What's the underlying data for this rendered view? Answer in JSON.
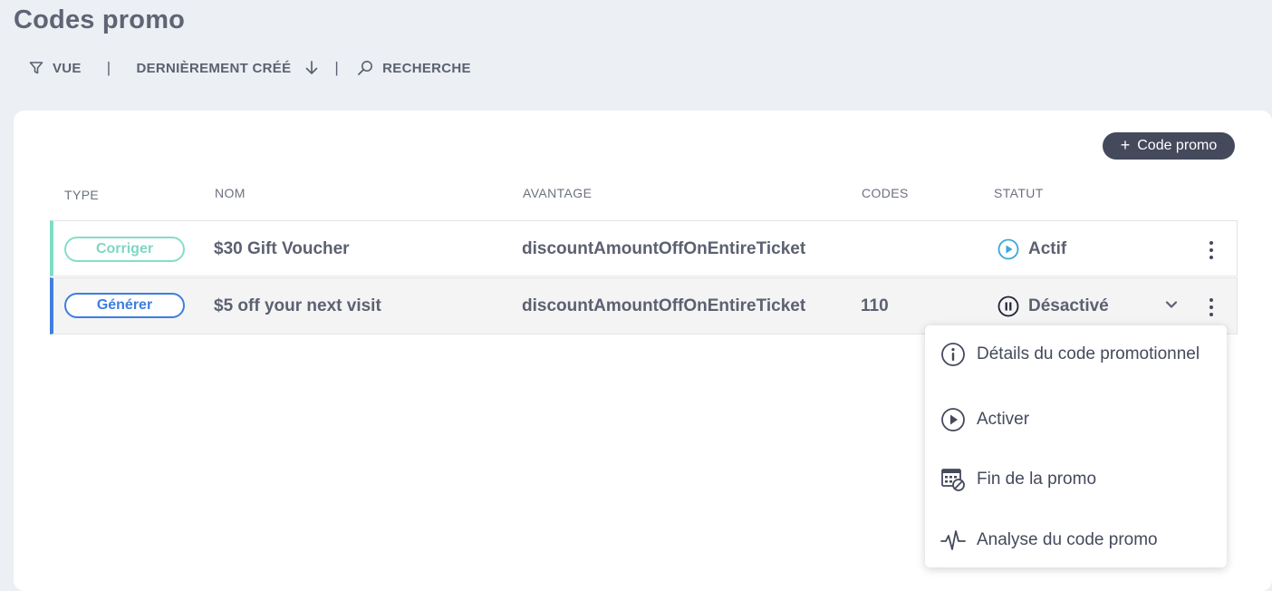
{
  "page": {
    "title": "Codes promo"
  },
  "toolbar": {
    "view_label": "VUE",
    "sort_label": "DERNIÈREMENT CRÉÉ",
    "search_label": "RECHERCHE",
    "separator": "|"
  },
  "actions": {
    "add_label": "Code promo",
    "add_icon": "+"
  },
  "table": {
    "headers": {
      "type": "TYPE",
      "name": "NOM",
      "benefit": "AVANTAGE",
      "codes": "CODES",
      "status": "STATUT"
    },
    "rows": [
      {
        "type": "Corriger",
        "name": "$30 Gift Voucher",
        "benefit": "discountAmountOffOnEntireTicket",
        "codes": "",
        "status": "Actif",
        "status_icon": "play-circle-icon",
        "accent_color": "#7fdcc6"
      },
      {
        "type": "Générer",
        "name": "$5 off your next visit",
        "benefit": "discountAmountOffOnEntireTicket",
        "codes": "110",
        "status": "Désactivé",
        "status_icon": "pause-circle-icon",
        "accent_color": "#3f7fe0"
      }
    ]
  },
  "context_menu": {
    "items": [
      {
        "label": "Détails du code promotionnel",
        "icon": "info-circle-icon"
      },
      {
        "label": "Activer",
        "icon": "play-circle-icon"
      },
      {
        "label": "Fin de la promo",
        "icon": "calendar-block-icon"
      },
      {
        "label": "Analyse du code promo",
        "icon": "pulse-icon"
      }
    ]
  },
  "colors": {
    "dark_button": "#444a5c",
    "teal": "#7fdcc6",
    "blue": "#3f7fe0",
    "active_icon": "#3aa9d8"
  }
}
